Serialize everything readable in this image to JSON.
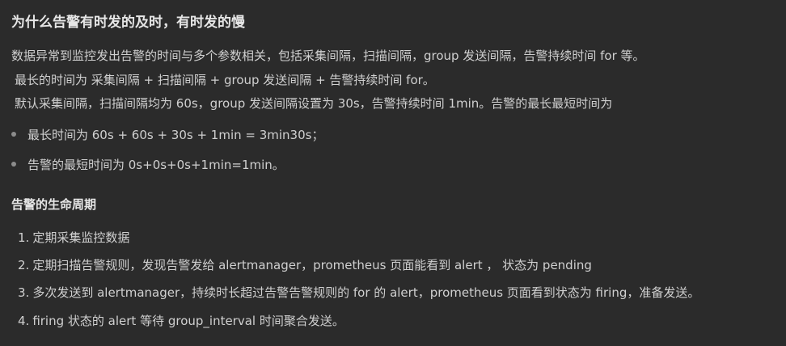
{
  "section1": {
    "title": "为什么告警有时发的及时，有时发的慢",
    "paragraphs": [
      "数据异常到监控发出告警的时间与多个参数相关，包括采集间隔，扫描间隔，group 发送间隔，告警持续时间 for 等。",
      "最长的时间为 采集间隔 + 扫描间隔 + group 发送间隔 + 告警持续时间 for。",
      "默认采集间隔，扫描间隔均为 60s，group 发送间隔设置为 30s，告警持续时间 1min。告警的最长最短时间为"
    ],
    "bullets": [
      "最长时间为 60s + 60s + 30s + 1min = 3min30s；",
      "告警的最短时间为 0s+0s+0s+1min=1min。"
    ]
  },
  "section2": {
    "title": "告警的生命周期",
    "steps": [
      {
        "num": "1.",
        "text": "定期采集监控数据"
      },
      {
        "num": "2.",
        "text": "定期扫描告警规则，发现告警发给 alertmanager，prometheus 页面能看到 alert ， 状态为 pending"
      },
      {
        "num": "3.",
        "text": "多次发送到 alertmanager，持续时长超过告警告警规则的 for 的 alert，prometheus 页面看到状态为 firing，准备发送。"
      },
      {
        "num": "4.",
        "text": "firing 状态的 alert 等待 group_interval 时间聚合发送。"
      }
    ]
  },
  "colors": {
    "background": "#2b2b2b",
    "text": "#d0d0d0",
    "heading": "#e6e6e6",
    "bullet": "#8c8c8c"
  }
}
